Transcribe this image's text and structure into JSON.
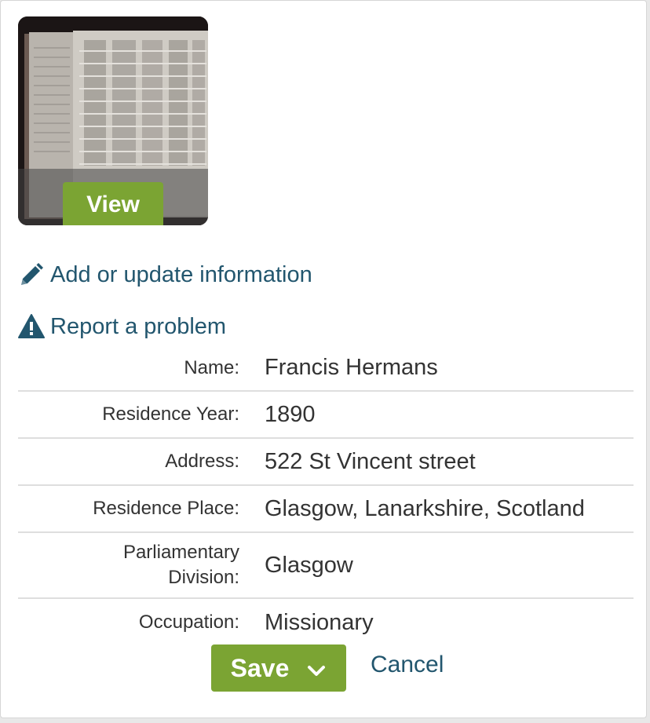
{
  "thumbnail": {
    "view_label": "View"
  },
  "actions": {
    "add_update_label": "Add or update information",
    "report_problem_label": "Report a problem"
  },
  "details": [
    {
      "label": "Name:",
      "value": "Francis Hermans"
    },
    {
      "label": "Residence Year:",
      "value": "1890"
    },
    {
      "label": "Address:",
      "value": "522 St Vincent street"
    },
    {
      "label": "Residence Place:",
      "value": "Glasgow, Lanarkshire, Scotland"
    },
    {
      "label_line1": "Parliamentary",
      "label_line2": "Division:",
      "value": "Glasgow"
    },
    {
      "label": "Occupation:",
      "value": "Missionary"
    }
  ],
  "footer": {
    "save_label": "Save",
    "cancel_label": "Cancel"
  },
  "colors": {
    "accent_green": "#7ba433",
    "link_blue": "#22566e",
    "text": "#333333"
  },
  "icons": [
    "pencil-icon",
    "warning-icon",
    "chevron-down-icon"
  ]
}
